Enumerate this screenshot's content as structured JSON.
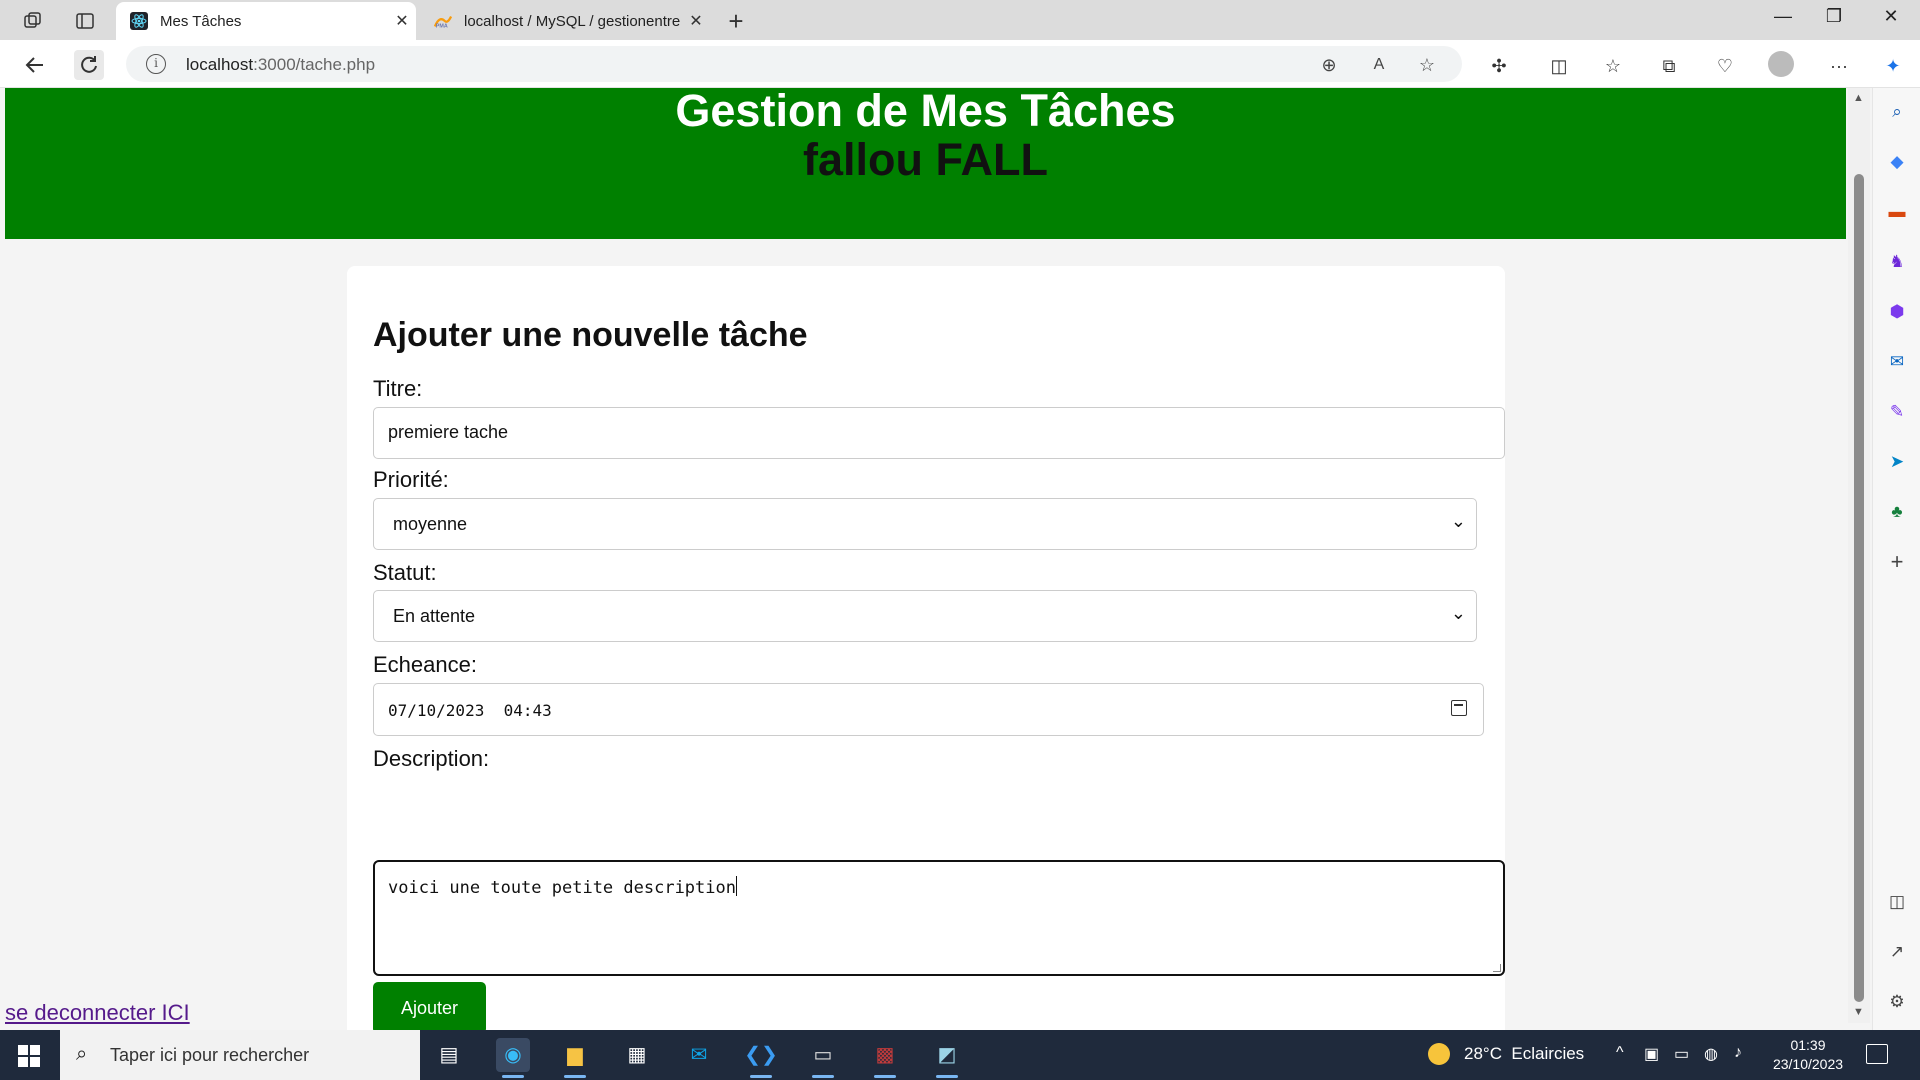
{
  "browser": {
    "tabs": [
      {
        "title": "Mes Tâches",
        "active": true
      },
      {
        "title": "localhost / MySQL / gestionentre",
        "active": false
      }
    ],
    "url_host": "localhost",
    "url_path": ":3000/tache.php"
  },
  "header": {
    "title": "Gestion de Mes Tâches",
    "user": "fallou FALL"
  },
  "form": {
    "heading": "Ajouter une nouvelle tâche",
    "title_label": "Titre:",
    "title_value": "premiere tache",
    "priority_label": "Priorité:",
    "priority_value": "moyenne",
    "status_label": "Statut:",
    "status_value": "En attente",
    "due_label": "Echeance:",
    "due_value": "07/10/2023  04:43",
    "description_label": "Description:",
    "description_value": "voici une toute petite description",
    "submit_label": "Ajouter"
  },
  "logout_link": "se deconnecter ICI",
  "taskbar": {
    "search_placeholder": "Taper ici pour rechercher",
    "weather": "28°C  Eclaircies",
    "time": "01:39",
    "date": "23/10/2023"
  },
  "colors": {
    "header_bg": "#008000",
    "button_bg": "#008000",
    "link": "#551a8b"
  }
}
